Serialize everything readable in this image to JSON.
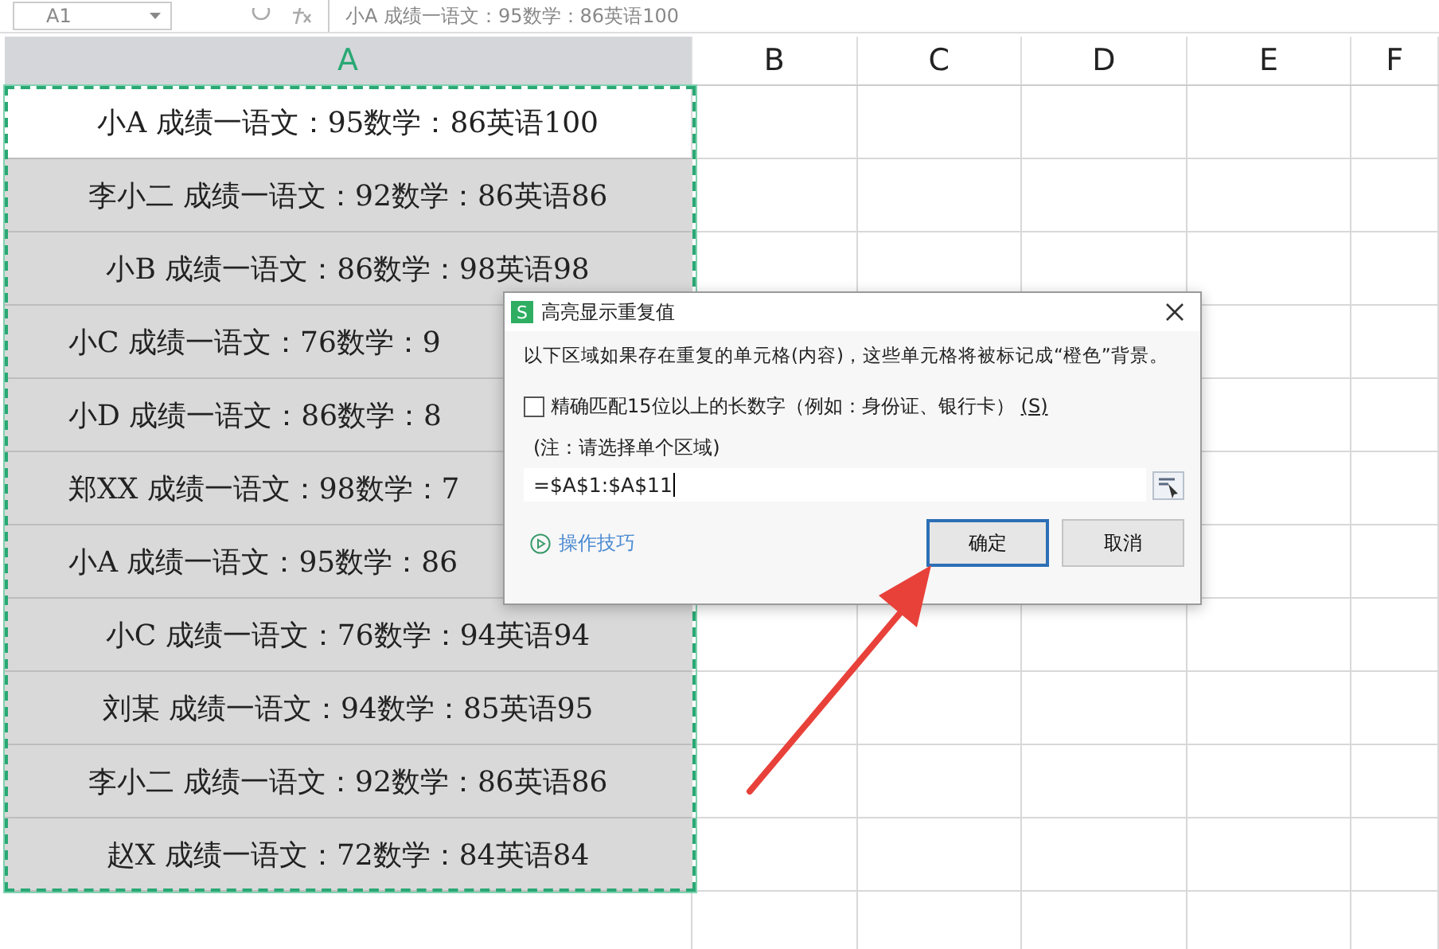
{
  "toolbar": {
    "name_box": "A1",
    "formula": "小A 成绩一语文：95数学：86英语100"
  },
  "columns": [
    {
      "label": "A",
      "selected": true
    },
    {
      "label": "B",
      "selected": false
    },
    {
      "label": "C",
      "selected": false
    },
    {
      "label": "D",
      "selected": false
    },
    {
      "label": "E",
      "selected": false
    },
    {
      "label": "F",
      "selected": false
    }
  ],
  "cells": [
    {
      "text": "小A 成绩一语文：95数学：86英语100",
      "active": true
    },
    {
      "text": "李小二 成绩一语文：92数学：86英语86",
      "active": false
    },
    {
      "text": "小B 成绩一语文：86数学：98英语98",
      "active": false
    },
    {
      "text": "小C 成绩一语文：76数学：9",
      "active": false,
      "covered": true
    },
    {
      "text": "小D 成绩一语文：86数学：8",
      "active": false,
      "covered": true
    },
    {
      "text": "郑XX 成绩一语文：98数学：7",
      "active": false,
      "covered": true
    },
    {
      "text": "小A 成绩一语文：95数学：86",
      "active": false,
      "covered": true
    },
    {
      "text": "小C 成绩一语文：76数学：94英语94",
      "active": false
    },
    {
      "text": "刘某 成绩一语文：94数学：85英语95",
      "active": false
    },
    {
      "text": "李小二 成绩一语文：92数学：86英语86",
      "active": false
    },
    {
      "text": "赵X 成绩一语文：72数学：84英语84",
      "active": false
    }
  ],
  "dialog": {
    "icon_text": "S",
    "title": "高亮显示重复值",
    "description": "以下区域如果存在重复的单元格(内容)，这些单元格将被标记成“橙色”背景。",
    "checkbox": {
      "label": "精确匹配15位以上的长数字（例如：身份证、银行卡）",
      "shortcut": "(S)",
      "checked": false
    },
    "note": "(注：请选择单个区域)",
    "range": "=$A$1:$A$11",
    "tips_link": "操作技巧",
    "buttons": [
      {
        "label": "确定",
        "kind": "primary"
      },
      {
        "label": "取消",
        "kind": "normal"
      }
    ]
  }
}
